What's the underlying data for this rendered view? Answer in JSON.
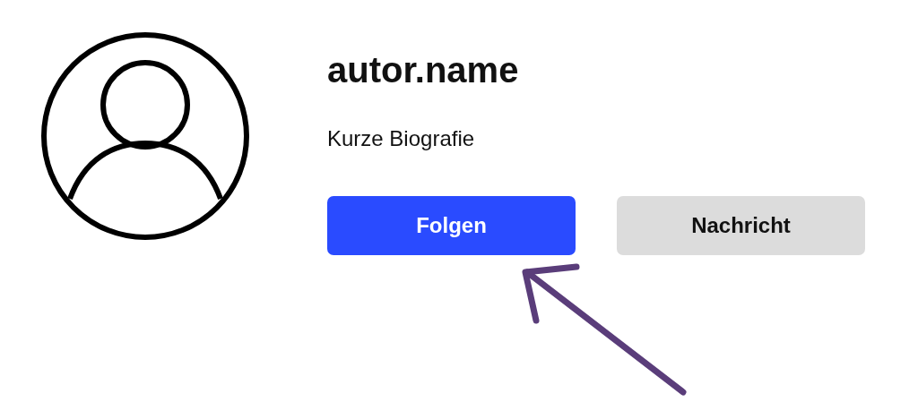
{
  "profile": {
    "username": "autor.name",
    "bio": "Kurze Biografie"
  },
  "buttons": [
    {
      "label": "Folgen",
      "kind": "primary"
    },
    {
      "label": "Nachricht",
      "kind": "secondary"
    }
  ],
  "annotations": [
    {
      "kind": "arrow"
    }
  ]
}
